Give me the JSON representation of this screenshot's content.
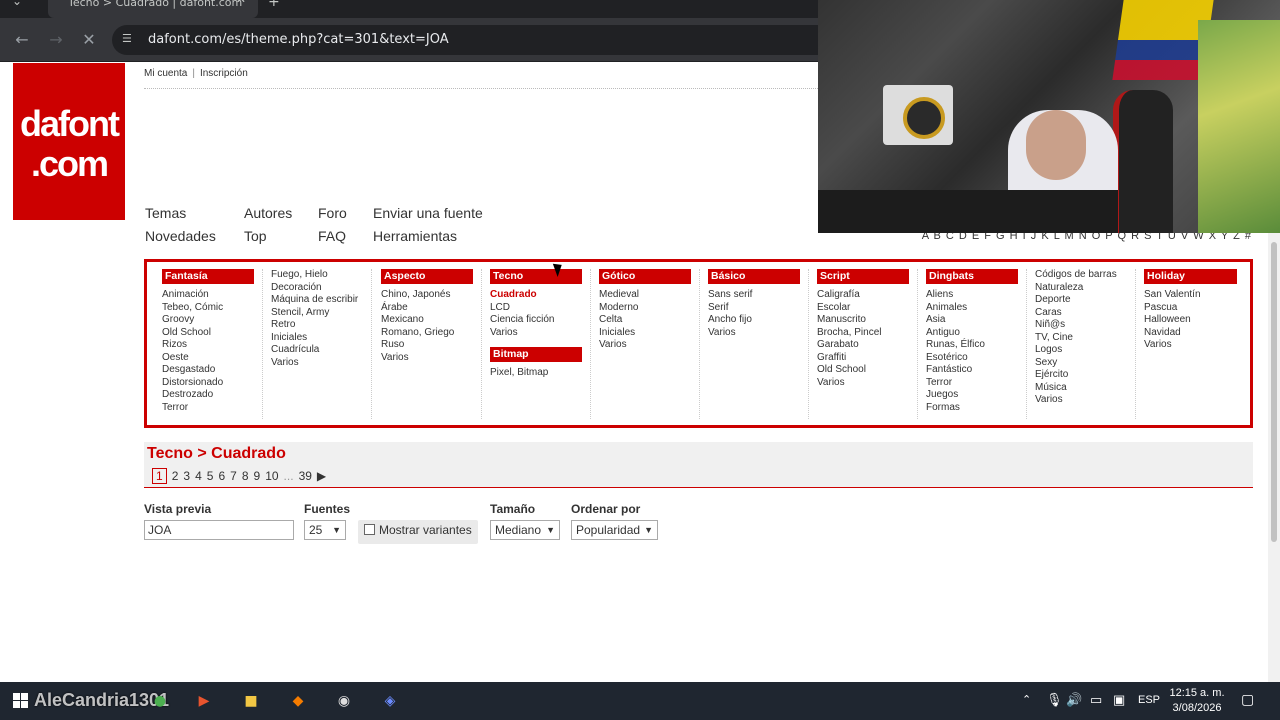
{
  "browser": {
    "tab_title": "Tecno > Cuadrado | dafont.com",
    "url": "dafont.com/es/theme.php?cat=301&text=JOA"
  },
  "site": {
    "logo_line1": "dafont",
    "logo_line2": ".com",
    "account_link": "Mi cuenta",
    "register_link": "Inscripción",
    "nav": {
      "temas": "Temas",
      "novedades": "Novedades",
      "autores": "Autores",
      "top": "Top",
      "foro": "Foro",
      "faq": "FAQ",
      "enviar": "Enviar una fuente",
      "herramientas": "Herramientas"
    },
    "alphabet": "A B C D E F G H I J K L M N O P Q R S T U V W X Y Z #"
  },
  "categories": [
    {
      "head": "Fantasía",
      "items": [
        "Animación",
        "Tebeo, Cómic",
        "Groovy",
        "Old School",
        "Rizos",
        "Oeste",
        "Desgastado",
        "Distorsionado",
        "Destrozado",
        "Terror"
      ]
    },
    {
      "head": "",
      "items": [
        "Fuego, Hielo",
        "Decoración",
        "Máquina de escribir",
        "Stencil, Army",
        "Retro",
        "Iniciales",
        "Cuadrícula",
        "Varios"
      ]
    },
    {
      "head": "Aspecto extranjero",
      "items": [
        "Chino, Japonés",
        "Árabe",
        "Mexicano",
        "Romano, Griego",
        "Ruso",
        "Varios"
      ]
    },
    {
      "head": "Tecno",
      "items": [
        "Cuadrado",
        "LCD",
        "Ciencia ficción",
        "Varios"
      ],
      "sub_head": "Bitmap",
      "sub_items": [
        "Pixel, Bitmap"
      ]
    },
    {
      "head": "Gótico",
      "items": [
        "Medieval",
        "Moderno",
        "Celta",
        "Iniciales",
        "Varios"
      ]
    },
    {
      "head": "Básico",
      "items": [
        "Sans serif",
        "Serif",
        "Ancho fijo",
        "Varios"
      ]
    },
    {
      "head": "Script",
      "items": [
        "Caligrafía",
        "Escolar",
        "Manuscrito",
        "Brocha, Pincel",
        "Garabato",
        "Graffiti",
        "Old School",
        "Varios"
      ]
    },
    {
      "head": "Dingbats",
      "items": [
        "Aliens",
        "Animales",
        "Asia",
        "Antiguo",
        "Runas, Élfico",
        "Esotérico",
        "Fantástico",
        "Terror",
        "Juegos",
        "Formas"
      ]
    },
    {
      "head": "",
      "items": [
        "Códigos de barras",
        "Naturaleza",
        "Deporte",
        "Caras",
        "Niñ@s",
        "TV, Cine",
        "Logos",
        "Sexy",
        "Ejército",
        "Música",
        "Varios"
      ]
    },
    {
      "head": "Holiday",
      "items": [
        "San Valentín",
        "Pascua",
        "Halloween",
        "Navidad",
        "Varios"
      ]
    }
  ],
  "active_category": "Cuadrado",
  "results": {
    "breadcrumb": "Tecno > Cuadrado",
    "pages": [
      "1",
      "2",
      "3",
      "4",
      "5",
      "6",
      "7",
      "8",
      "9",
      "10"
    ],
    "current_page": "1",
    "ellipsis": "...",
    "last_page": "39",
    "next_arrow": "▶"
  },
  "form": {
    "preview_label": "Vista previa",
    "preview_value": "JOA",
    "fonts_label": "Fuentes",
    "fonts_value": "25",
    "variants_label": "Mostrar variantes",
    "size_label": "Tamaño",
    "size_value": "Mediano",
    "order_label": "Ordenar por",
    "order_value": "Popularidad"
  },
  "taskbar": {
    "watermark": "AleCandria1301",
    "lang": "ESP",
    "time": "12:15 a. m.",
    "date": "3/08/2026"
  }
}
